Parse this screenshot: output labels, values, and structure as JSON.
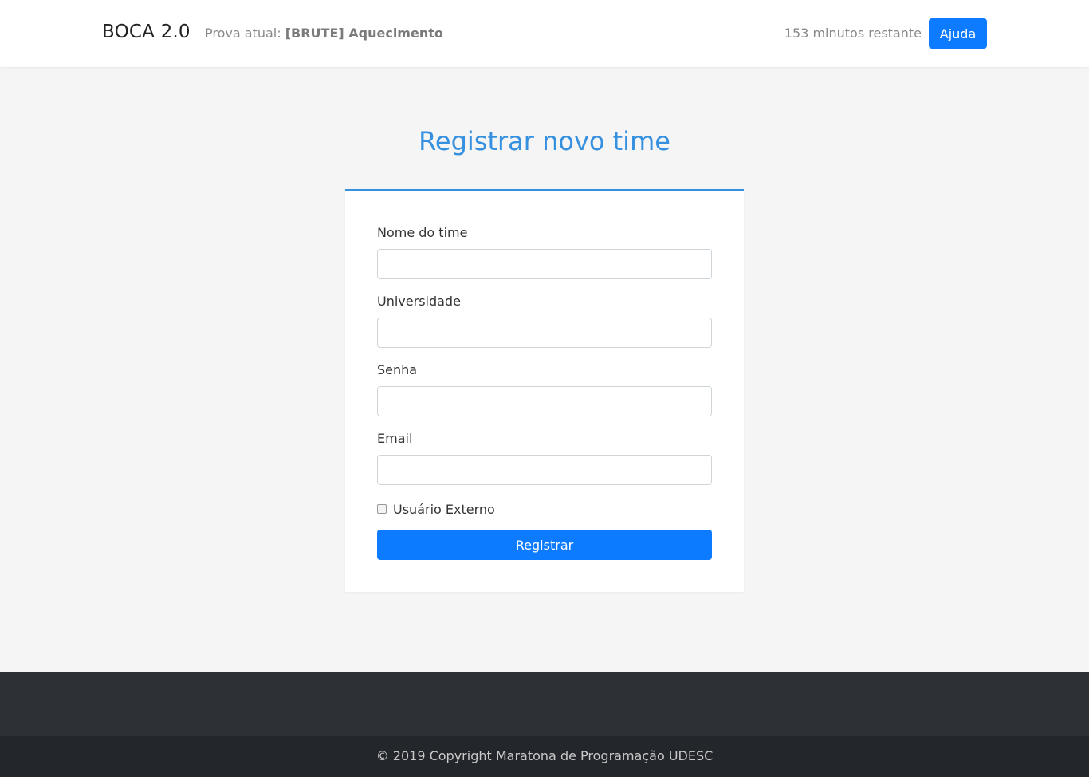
{
  "header": {
    "brand": "BOCA 2.0",
    "contest_prefix": "Prova atual:",
    "contest_name": "[BRUTE] Aquecimento",
    "time_remaining": "153 minutos restante",
    "help_label": "Ajuda"
  },
  "form": {
    "title": "Registrar novo time",
    "fields": [
      {
        "label": "Nome do time",
        "value": ""
      },
      {
        "label": "Universidade",
        "value": ""
      },
      {
        "label": "Senha",
        "value": ""
      },
      {
        "label": "Email",
        "value": ""
      }
    ],
    "checkbox_label": "Usuário Externo",
    "checkbox_checked": false,
    "submit_label": "Registrar"
  },
  "footer": {
    "copyright": "© 2019 Copyright Maratona de Programação UDESC"
  },
  "colors": {
    "accent": "#0d7bff",
    "title": "#3590df",
    "footer_dark": "#23262a",
    "footer_mid": "#2d3136"
  }
}
